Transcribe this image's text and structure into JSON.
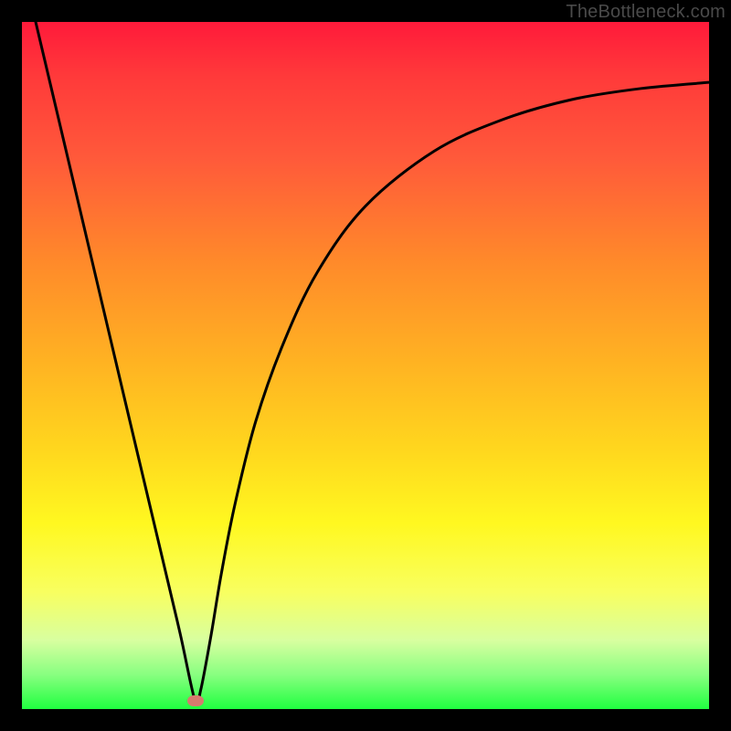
{
  "attribution": "TheBottleneck.com",
  "chart_data": {
    "type": "line",
    "title": "",
    "xlabel": "",
    "ylabel": "",
    "xlim": [
      0,
      1
    ],
    "ylim": [
      0,
      1
    ],
    "legend": false,
    "grid": false,
    "series": [
      {
        "name": "bottleneck-curve",
        "x": [
          0.02,
          0.05,
          0.1,
          0.15,
          0.2,
          0.23,
          0.252,
          0.26,
          0.275,
          0.29,
          0.31,
          0.34,
          0.38,
          0.43,
          0.5,
          0.6,
          0.7,
          0.8,
          0.9,
          1.0
        ],
        "values": [
          1.0,
          0.873,
          0.661,
          0.449,
          0.238,
          0.111,
          0.012,
          0.027,
          0.106,
          0.196,
          0.298,
          0.418,
          0.531,
          0.636,
          0.732,
          0.812,
          0.858,
          0.887,
          0.903,
          0.912
        ]
      }
    ],
    "markers": [
      {
        "name": "optimum-point",
        "x": 0.252,
        "y": 0.012,
        "color": "#d67a6e"
      }
    ],
    "background_gradient": {
      "direction": "vertical",
      "stops": [
        {
          "pos": 0.0,
          "color": "#ff1a3a"
        },
        {
          "pos": 0.5,
          "color": "#ffb422"
        },
        {
          "pos": 0.75,
          "color": "#fff820"
        },
        {
          "pos": 1.0,
          "color": "#20ff40"
        }
      ]
    }
  }
}
